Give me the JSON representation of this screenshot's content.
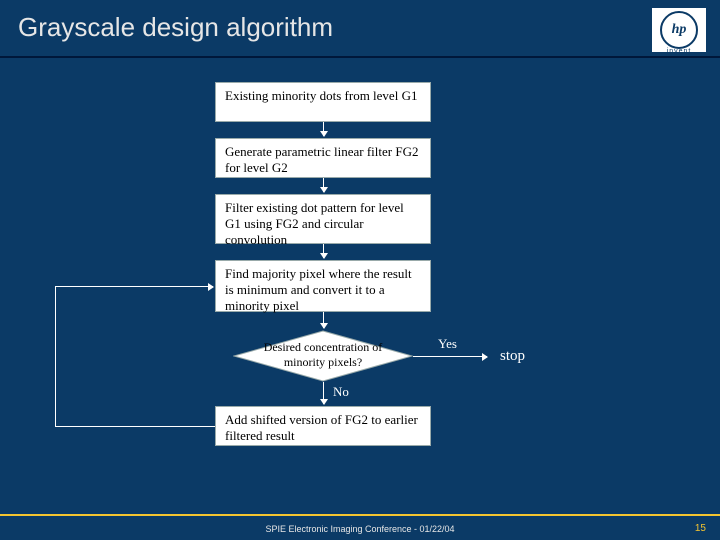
{
  "title": "Grayscale design algorithm",
  "logo": {
    "mark": "hp",
    "tagline": "invent"
  },
  "flow": {
    "box1": "Existing minority dots from level G1",
    "box2": "Generate parametric linear filter FG2 for level G2",
    "box3": "Filter existing dot pattern for level G1 using FG2 and circular convolution",
    "box4": "Find majority pixel where the result is minimum and convert it to a minority pixel",
    "decision": "Desired concentration of minority pixels?",
    "yes": "Yes",
    "no": "No",
    "stop": "stop",
    "box5": "Add shifted version of FG2 to earlier filtered result"
  },
  "footer": "SPIE Electronic Imaging Conference - 01/22/04",
  "page": "15"
}
